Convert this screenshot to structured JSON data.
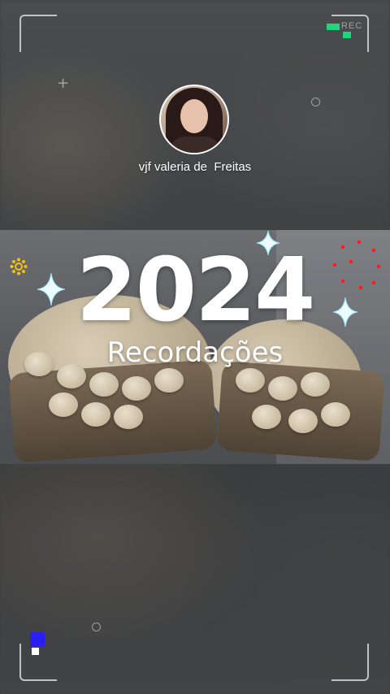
{
  "status": {
    "rec_label": "REC"
  },
  "profile": {
    "username": "vjf valeria de  Freitas",
    "avatar_icon": "user-avatar"
  },
  "title": {
    "year": "2024",
    "caption": "Recordações"
  },
  "colors": {
    "accent_green": "#1fd47a",
    "accent_blue": "#2a1ff0",
    "accent_red": "#ff1e1e",
    "text": "#ffffff"
  }
}
